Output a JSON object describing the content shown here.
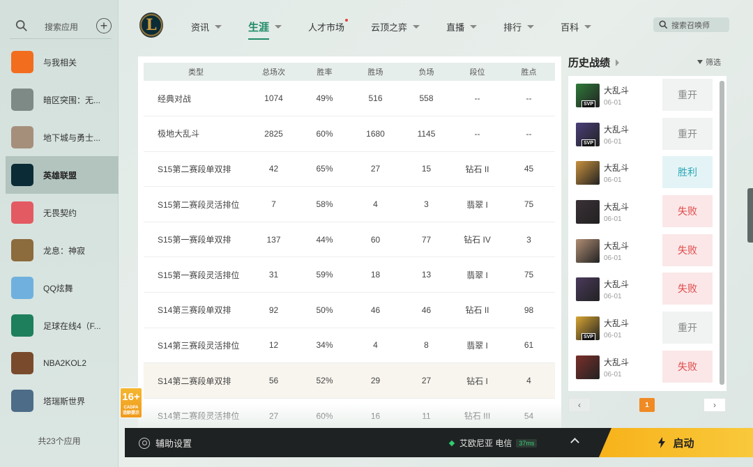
{
  "sidebar": {
    "search_placeholder": "搜索应用",
    "apps": [
      {
        "label": "与我相关",
        "icon": "related-icon",
        "color": "#f36d1e"
      },
      {
        "label": "暗区突围：无...",
        "icon": "game-icon",
        "color": "#7d8a86"
      },
      {
        "label": "地下城与勇士...",
        "icon": "game-icon",
        "color": "#a58f7b"
      },
      {
        "label": "英雄联盟",
        "icon": "lol-icon",
        "color": "#0b2b36"
      },
      {
        "label": "无畏契约",
        "icon": "valorant-icon",
        "color": "#e45a62"
      },
      {
        "label": "龙息：神寂",
        "icon": "game-icon",
        "color": "#8c6b3c"
      },
      {
        "label": "QQ炫舞",
        "icon": "game-icon",
        "color": "#6fb0de"
      },
      {
        "label": "足球在线4（F...",
        "icon": "game-icon",
        "color": "#1e7f5c"
      },
      {
        "label": "NBA2KOL2",
        "icon": "game-icon",
        "color": "#7a4a2c"
      },
      {
        "label": "塔瑞斯世界",
        "icon": "game-icon",
        "color": "#4d6c88"
      }
    ],
    "active_index": 3,
    "app_count": "共23个应用"
  },
  "nav": {
    "items": [
      {
        "label": "资讯",
        "caret": true
      },
      {
        "label": "生涯",
        "caret": true,
        "active": true
      },
      {
        "label": "人才市场",
        "caret": false,
        "dot": true
      },
      {
        "label": "云顶之弈",
        "caret": true
      },
      {
        "label": "直播",
        "caret": true
      },
      {
        "label": "排行",
        "caret": true
      },
      {
        "label": "百科",
        "caret": true
      }
    ],
    "summoner_search": "搜索召唤师"
  },
  "table": {
    "headers": [
      "类型",
      "总场次",
      "胜率",
      "胜场",
      "负场",
      "段位",
      "胜点"
    ],
    "rows": [
      [
        "经典对战",
        "1074",
        "49%",
        "516",
        "558",
        "--",
        "--"
      ],
      [
        "极地大乱斗",
        "2825",
        "60%",
        "1680",
        "1145",
        "--",
        "--"
      ],
      [
        "S15第二赛段单双排",
        "42",
        "65%",
        "27",
        "15",
        "钻石 II",
        "45"
      ],
      [
        "S15第二赛段灵活排位",
        "7",
        "58%",
        "4",
        "3",
        "翡翠 I",
        "75"
      ],
      [
        "S15第一赛段单双排",
        "137",
        "44%",
        "60",
        "77",
        "钻石 IV",
        "3"
      ],
      [
        "S15第一赛段灵活排位",
        "31",
        "59%",
        "18",
        "13",
        "翡翠 I",
        "75"
      ],
      [
        "S14第三赛段单双排",
        "92",
        "50%",
        "46",
        "46",
        "钻石 II",
        "98"
      ],
      [
        "S14第三赛段灵活排位",
        "12",
        "34%",
        "4",
        "8",
        "翡翠 I",
        "61"
      ],
      [
        "S14第二赛段单双排",
        "56",
        "52%",
        "29",
        "27",
        "钻石 I",
        "4"
      ],
      [
        "S14第二赛段灵活排位",
        "27",
        "60%",
        "16",
        "11",
        "钻石 III",
        "54"
      ]
    ],
    "highlight_row": 8
  },
  "age_badge": {
    "big": "16+",
    "small": "CADPA",
    "caption": "适龄提示"
  },
  "history": {
    "title": "历史战绩",
    "filter": "筛选",
    "matches": [
      {
        "mode": "大乱斗",
        "date": "06-01",
        "result": "重开",
        "kind": "remake",
        "svp": true,
        "color": "#2f7a3a"
      },
      {
        "mode": "大乱斗",
        "date": "06-01",
        "result": "重开",
        "kind": "remake",
        "svp": true,
        "color": "#4b3f7a"
      },
      {
        "mode": "大乱斗",
        "date": "06-01",
        "result": "胜利",
        "kind": "win",
        "svp": false,
        "color": "#c9923e"
      },
      {
        "mode": "大乱斗",
        "date": "06-01",
        "result": "失败",
        "kind": "lose",
        "svp": false,
        "color": "#3a3036"
      },
      {
        "mode": "大乱斗",
        "date": "06-01",
        "result": "失败",
        "kind": "lose",
        "svp": false,
        "color": "#b18e75"
      },
      {
        "mode": "大乱斗",
        "date": "06-01",
        "result": "失败",
        "kind": "lose",
        "svp": false,
        "color": "#4a3a5c"
      },
      {
        "mode": "大乱斗",
        "date": "06-01",
        "result": "重开",
        "kind": "remake",
        "svp": true,
        "color": "#d8a533"
      },
      {
        "mode": "大乱斗",
        "date": "06-01",
        "result": "失败",
        "kind": "lose",
        "svp": false,
        "color": "#7a2f2a"
      }
    ],
    "svp_label": "SVP",
    "page": "1",
    "prev": "‹",
    "next": "›"
  },
  "bottom": {
    "assist_label": "辅助设置",
    "server": "艾欧尼亚 电信",
    "ping": "37ms",
    "launch_label": "启动"
  },
  "logo_letter": "L"
}
